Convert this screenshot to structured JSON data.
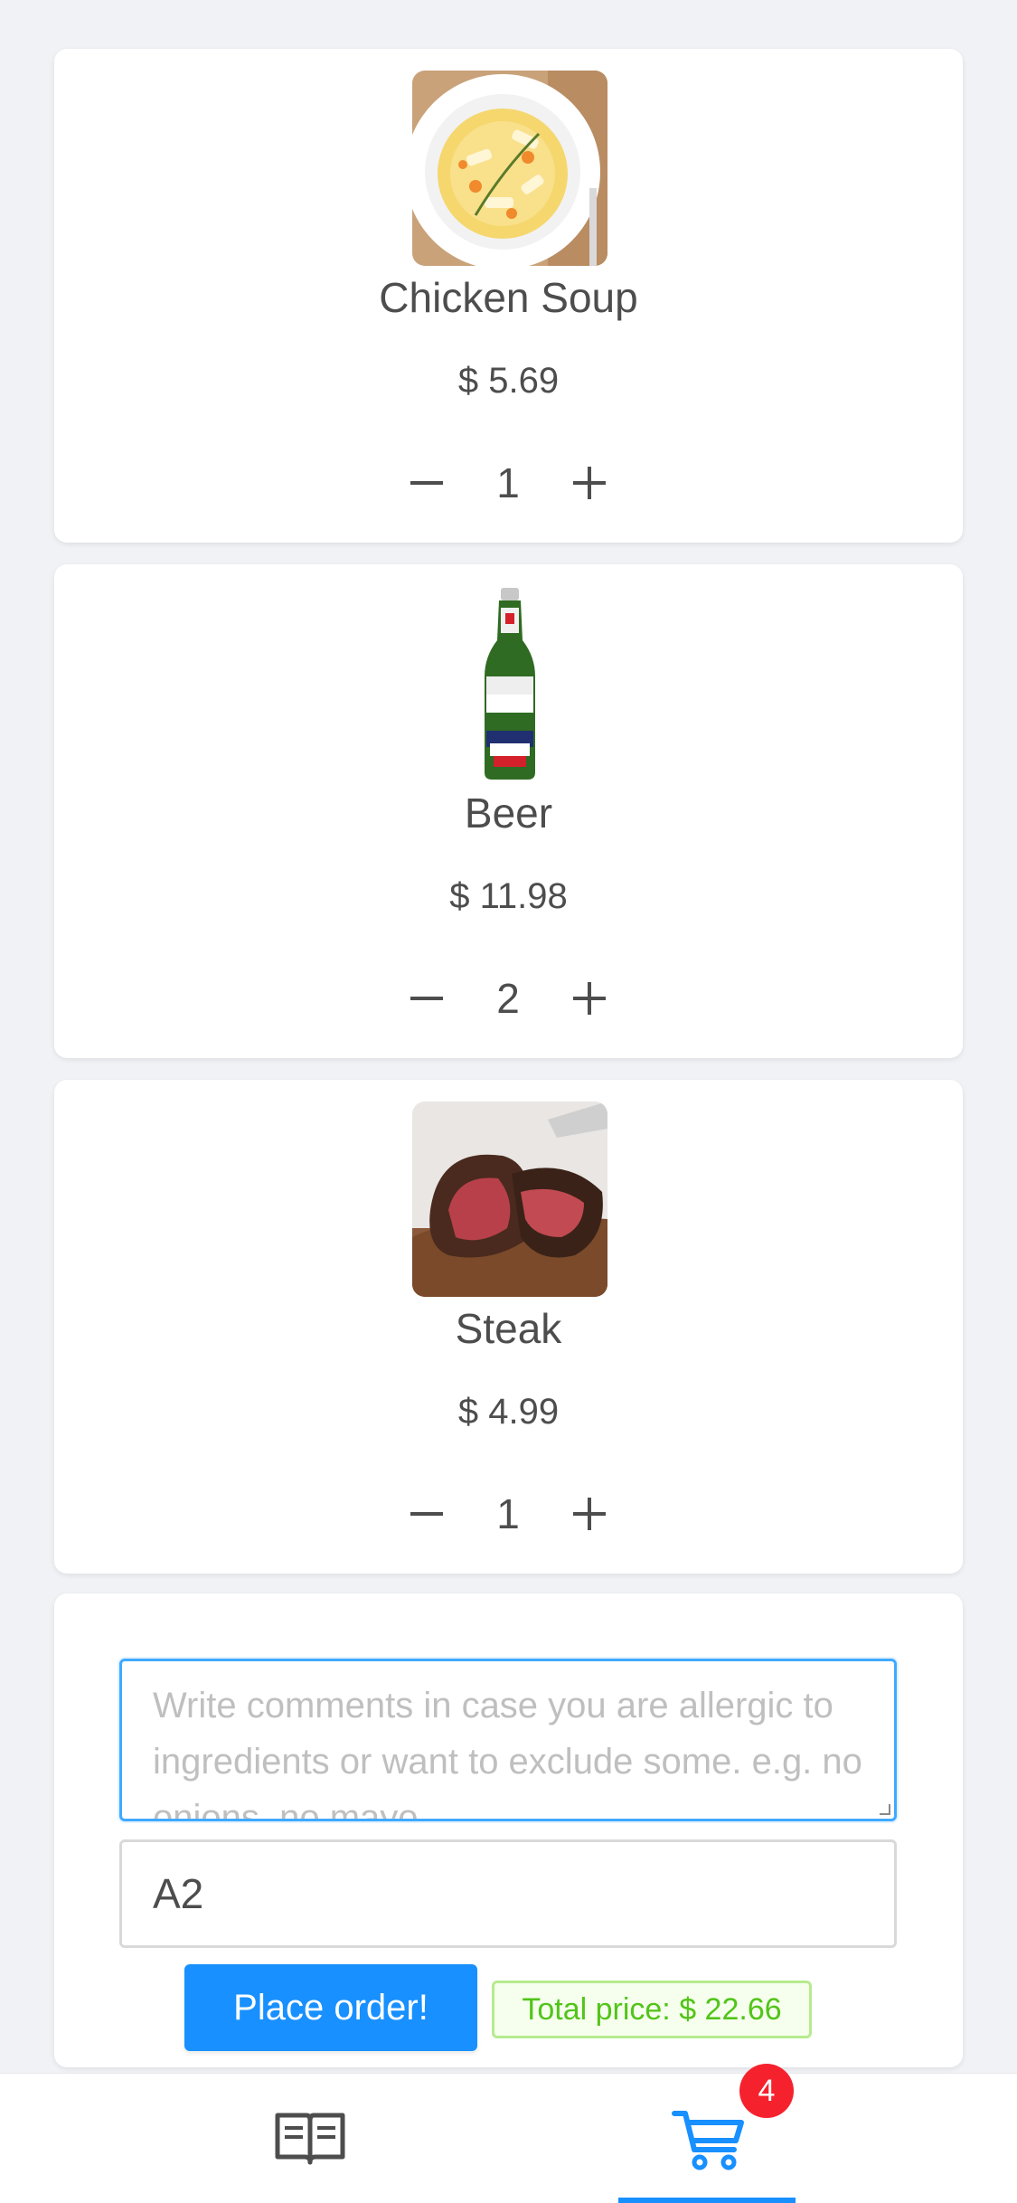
{
  "cart_items": [
    {
      "name": "Chicken Soup",
      "price": "$ 5.69",
      "quantity": "1",
      "image_icon": "chicken-soup-photo"
    },
    {
      "name": "Beer",
      "price": "$ 11.98",
      "quantity": "2",
      "image_icon": "beer-bottle-photo"
    },
    {
      "name": "Steak",
      "price": "$ 4.99",
      "quantity": "1",
      "image_icon": "steak-photo"
    }
  ],
  "order": {
    "comments_placeholder": "Write comments in case you are allergic to ingredients or want to exclude some. e.g. no onions, no mayo",
    "table_value": "A2",
    "place_order_label": "Place order!",
    "total_label": "Total price: $ 22.66"
  },
  "tabbar": {
    "tabs": [
      {
        "name": "menu",
        "icon": "open-book-icon",
        "active": false
      },
      {
        "name": "cart",
        "icon": "shopping-cart-icon",
        "active": true
      }
    ],
    "cart_badge": "4"
  },
  "colors": {
    "accent": "#1890ff",
    "badge": "#f5222d",
    "success_text": "#52c41a",
    "success_bg": "#f6ffed",
    "page_bg": "#f0f2f5"
  }
}
